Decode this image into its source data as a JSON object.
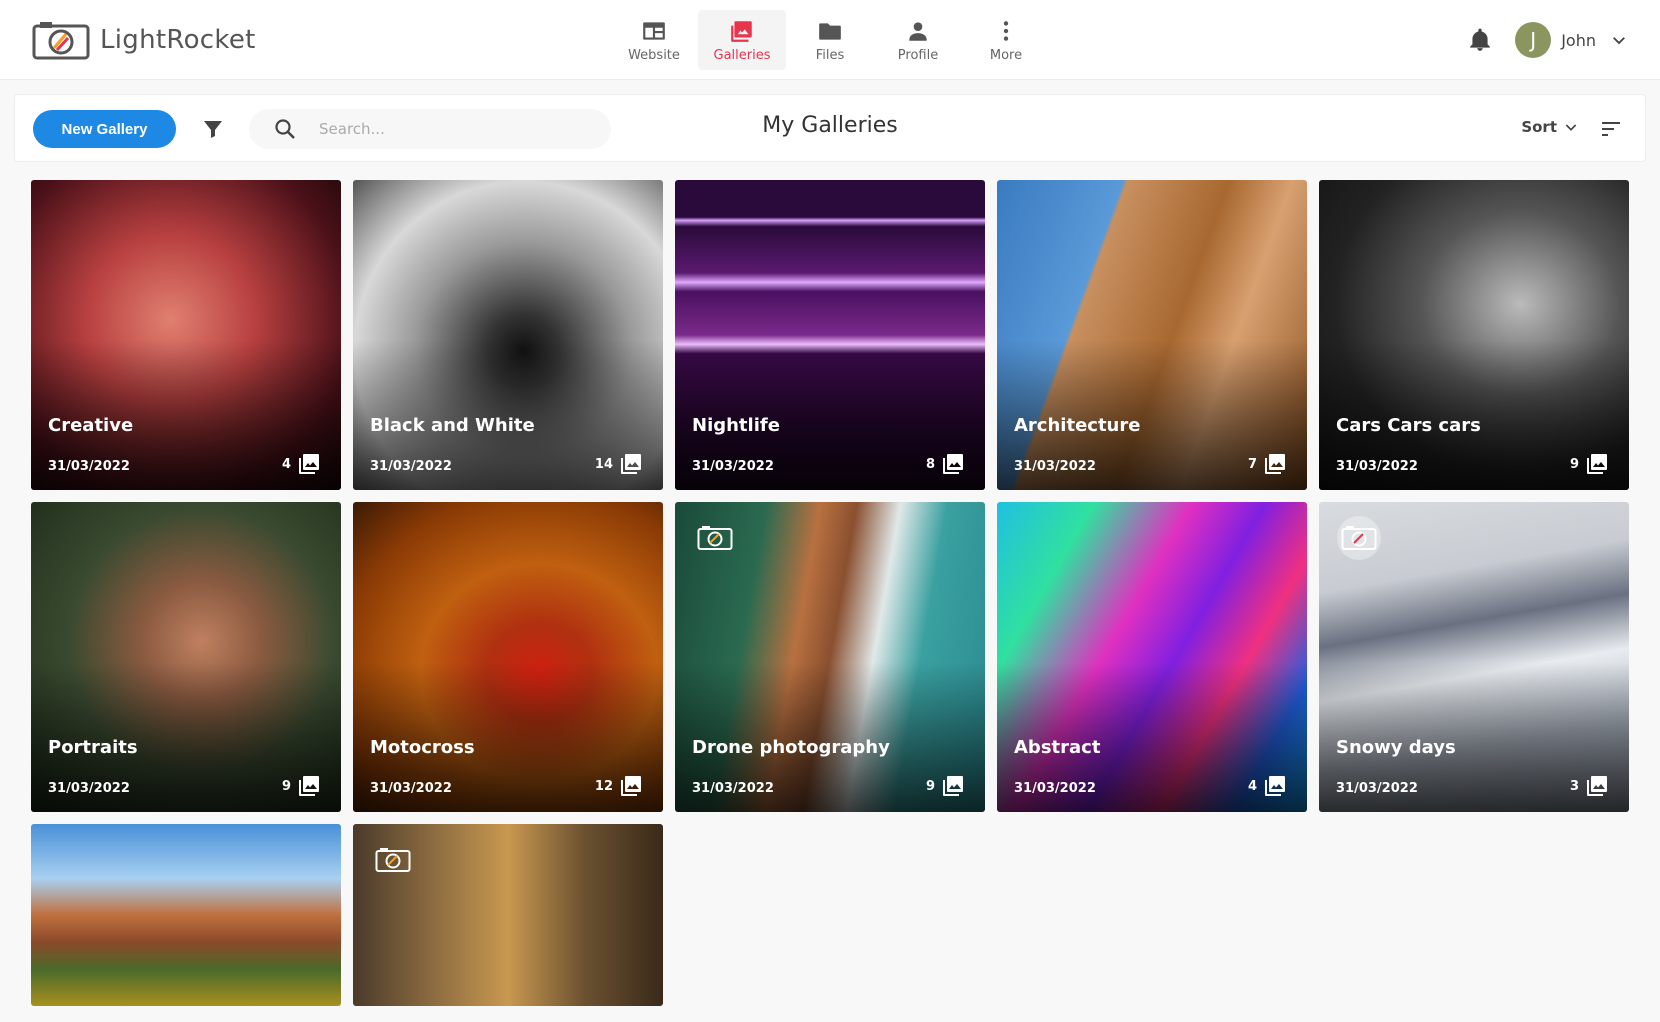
{
  "app": {
    "name": "LightRocket"
  },
  "nav": {
    "items": [
      {
        "label": "Website",
        "icon": "website-icon"
      },
      {
        "label": "Galleries",
        "icon": "galleries-icon",
        "active": true
      },
      {
        "label": "Files",
        "icon": "folder-icon"
      },
      {
        "label": "Profile",
        "icon": "person-icon"
      },
      {
        "label": "More",
        "icon": "more-vertical-icon"
      }
    ]
  },
  "user": {
    "initial": "J",
    "name": "John",
    "avatar_color": "#8b9560"
  },
  "toolbar": {
    "new_gallery_label": "New Gallery",
    "search_placeholder": "Search...",
    "page_title": "My Galleries",
    "sort_label": "Sort"
  },
  "colors": {
    "accent": "#1e88e5",
    "active_nav": "#e8344e"
  },
  "galleries": [
    {
      "title": "Creative",
      "date": "31/03/2022",
      "count": "4"
    },
    {
      "title": "Black and White",
      "date": "31/03/2022",
      "count": "14"
    },
    {
      "title": "Nightlife",
      "date": "31/03/2022",
      "count": "8"
    },
    {
      "title": "Architecture",
      "date": "31/03/2022",
      "count": "7"
    },
    {
      "title": "Cars Cars cars",
      "date": "31/03/2022",
      "count": "9"
    },
    {
      "title": "Portraits",
      "date": "31/03/2022",
      "count": "9"
    },
    {
      "title": "Motocross",
      "date": "31/03/2022",
      "count": "12"
    },
    {
      "title": "Drone photography",
      "date": "31/03/2022",
      "count": "9"
    },
    {
      "title": "Abstract",
      "date": "31/03/2022",
      "count": "4"
    },
    {
      "title": "Snowy days",
      "date": "31/03/2022",
      "count": "3"
    },
    {
      "title": "",
      "date": "",
      "count": ""
    },
    {
      "title": "",
      "date": "",
      "count": ""
    }
  ]
}
